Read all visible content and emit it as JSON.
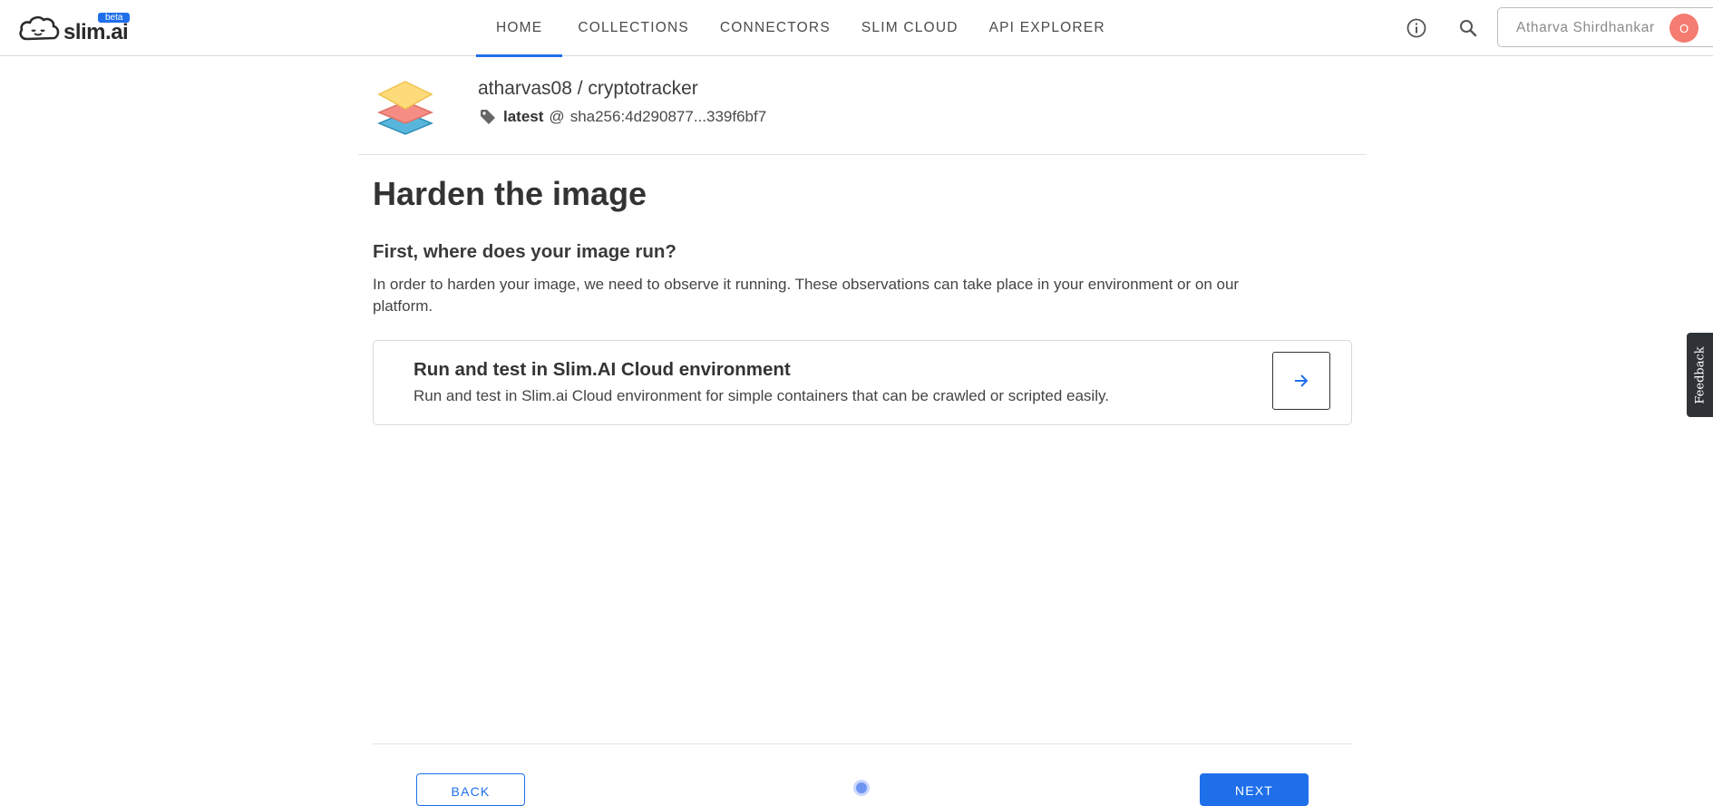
{
  "header": {
    "logo": {
      "text": "slim.ai",
      "badge": "beta",
      "icon": "cloud-face-logo"
    },
    "nav": [
      {
        "label": "HOME",
        "active": true
      },
      {
        "label": "COLLECTIONS",
        "active": false
      },
      {
        "label": "CONNECTORS",
        "active": false
      },
      {
        "label": "SLIM CLOUD",
        "active": false
      },
      {
        "label": "API EXPLORER",
        "active": false
      }
    ],
    "info_icon": "info-icon",
    "search_icon": "search-icon",
    "user": {
      "name": "Atharva Shirdhankar",
      "avatar_initial": "O",
      "avatar_color": "#f47c70"
    }
  },
  "repo": {
    "icon": "stacked-layers-icon",
    "name": "atharvas08 / cryptotracker",
    "tag_icon": "tag-icon",
    "tag": "latest",
    "at": "@",
    "digest": "sha256:4d290877...339f6bf7"
  },
  "main": {
    "title": "Harden the image",
    "heading": "First, where does your image run?",
    "description": "In order to harden your image, we need to observe it running. These observations can take place in your environment or on our platform.",
    "option": {
      "title": "Run and test in Slim.AI Cloud environment",
      "description": "Run and test in Slim.ai Cloud environment for simple containers that can be crawled or scripted easily.",
      "arrow_icon": "arrow-right-icon"
    }
  },
  "feedback": {
    "label": "Feedback"
  },
  "footer": {
    "back_label": "BACK",
    "next_label": "NEXT"
  },
  "colors": {
    "accent": "#1f6feb",
    "text": "#333333",
    "border": "#d9d9d9"
  }
}
